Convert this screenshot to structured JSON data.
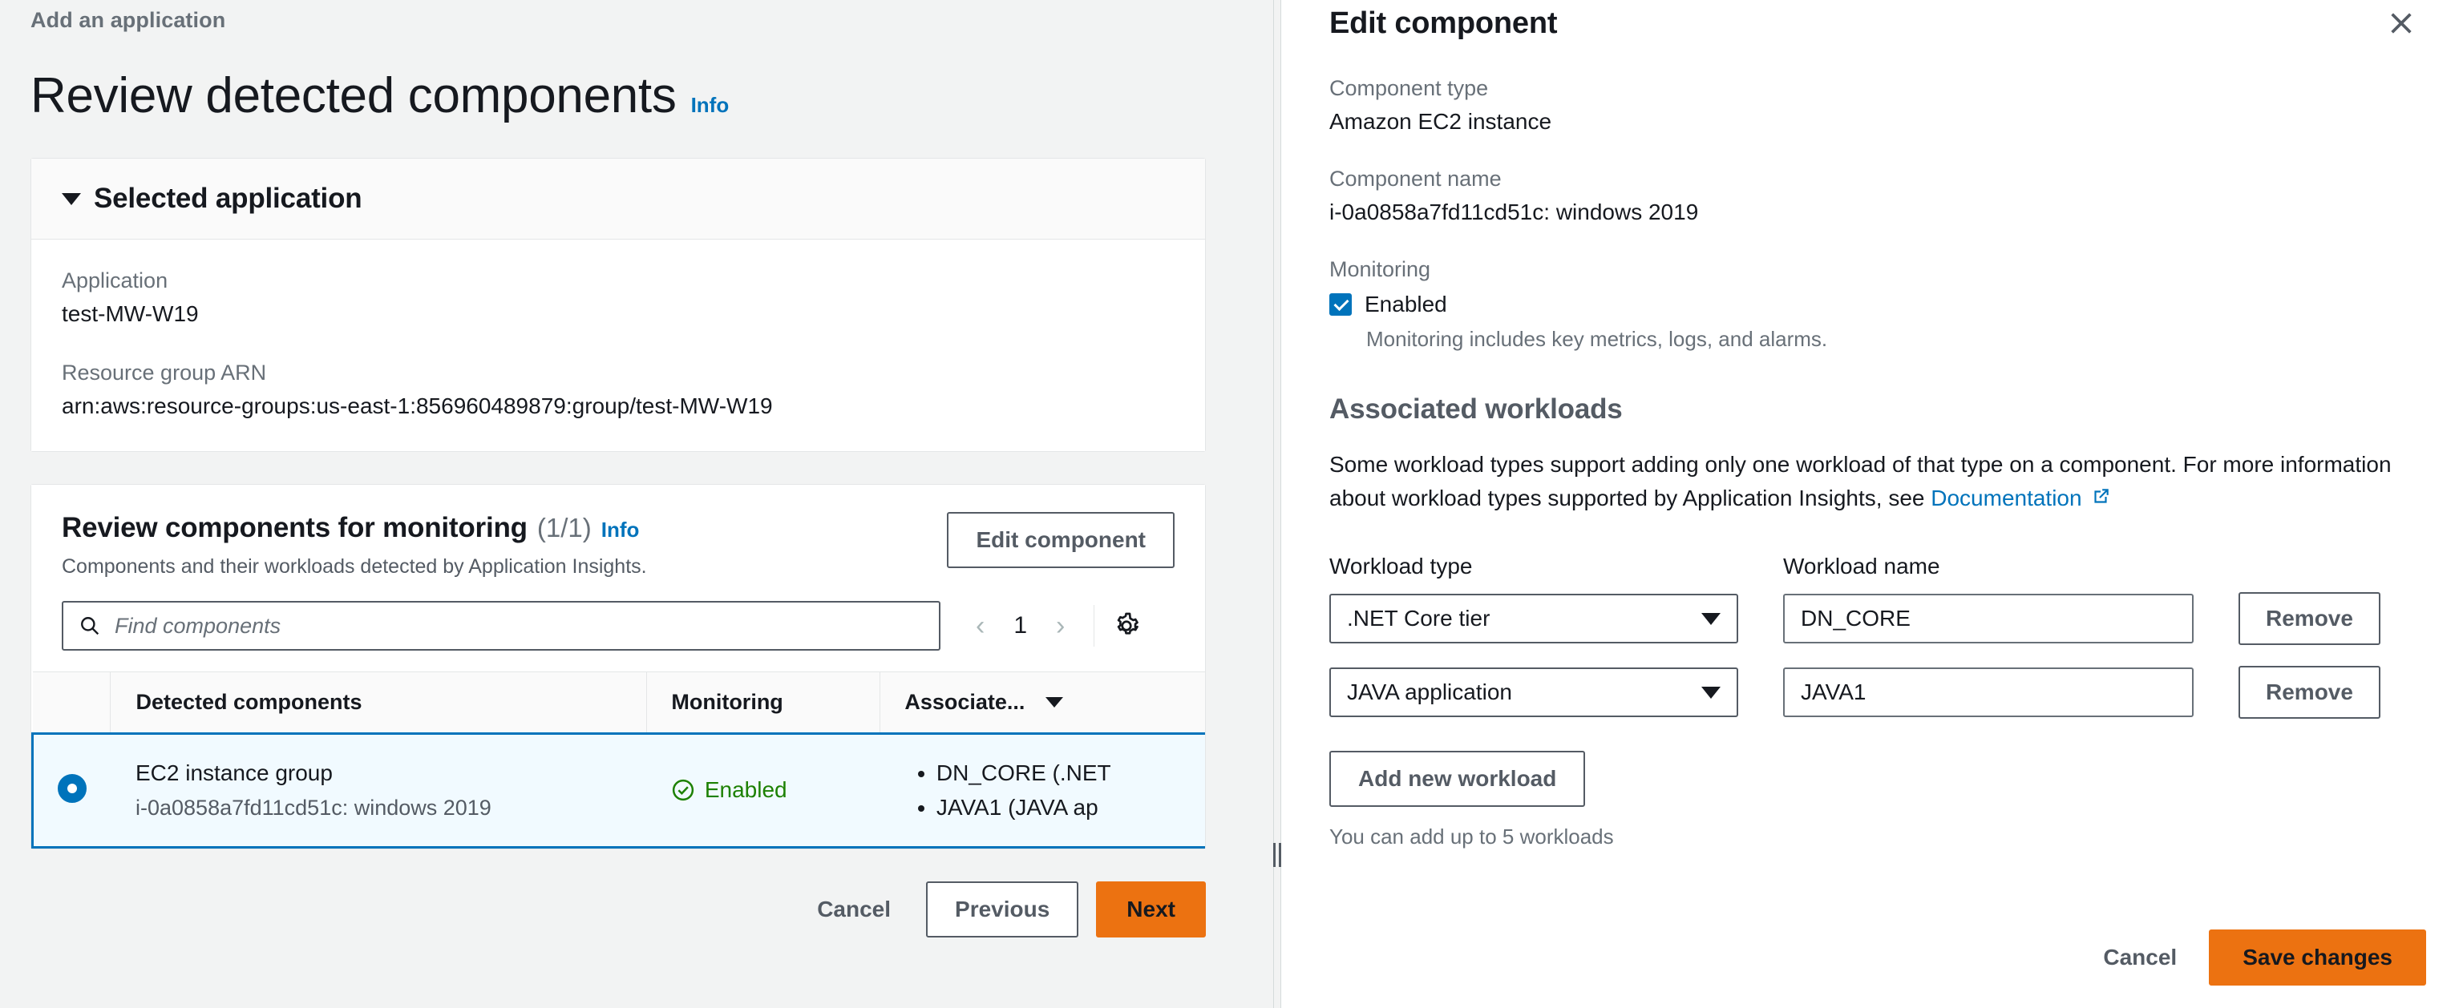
{
  "wizard": {
    "breadcrumb": "Add an application",
    "page_title": "Review detected components",
    "info_label": "Info",
    "selected_application": {
      "header": "Selected application",
      "application_label": "Application",
      "application_value": "test-MW-W19",
      "arn_label": "Resource group ARN",
      "arn_value": "arn:aws:resource-groups:us-east-1:856960489879:group/test-MW-W19"
    },
    "components_card": {
      "title": "Review components for monitoring",
      "count": "(1/1)",
      "info_label": "Info",
      "description": "Components and their workloads detected by Application Insights.",
      "edit_component_label": "Edit component",
      "search_placeholder": "Find components",
      "page_number": "1",
      "table": {
        "columns": [
          "Detected components",
          "Monitoring",
          "Associate..."
        ],
        "rows": [
          {
            "name": "EC2 instance group",
            "sub": "i-0a0858a7fd11cd51c: windows 2019",
            "monitoring": "Enabled",
            "workloads": [
              "DN_CORE (.NET",
              "JAVA1 (JAVA ap"
            ]
          }
        ]
      }
    },
    "footer": {
      "cancel_label": "Cancel",
      "previous_label": "Previous",
      "next_label": "Next"
    }
  },
  "panel": {
    "title": "Edit component",
    "component_type_label": "Component type",
    "component_type_value": "Amazon EC2 instance",
    "component_name_label": "Component name",
    "component_name_value": "i-0a0858a7fd11cd51c: windows 2019",
    "monitoring_label": "Monitoring",
    "monitoring_checkbox_label": "Enabled",
    "monitoring_help": "Monitoring includes key metrics, logs, and alarms.",
    "associated_workloads_title": "Associated workloads",
    "description_part1": "Some workload types support adding only one workload of that type on a component. For more information about workload types supported by Application Insights, see ",
    "documentation_link": "Documentation",
    "workload_type_label": "Workload type",
    "workload_name_label": "Workload name",
    "workloads": [
      {
        "type": ".NET Core tier",
        "name": "DN_CORE",
        "remove_label": "Remove"
      },
      {
        "type": "JAVA application",
        "name": "JAVA1",
        "remove_label": "Remove"
      }
    ],
    "add_workload_label": "Add new workload",
    "workload_hint": "You can add up to 5 workloads",
    "cancel_label": "Cancel",
    "save_label": "Save changes"
  },
  "colors": {
    "accent_orange": "#ec7211",
    "link_blue": "#0073bb",
    "success_green": "#1d8102",
    "selected_row_bg": "#f1faff"
  }
}
